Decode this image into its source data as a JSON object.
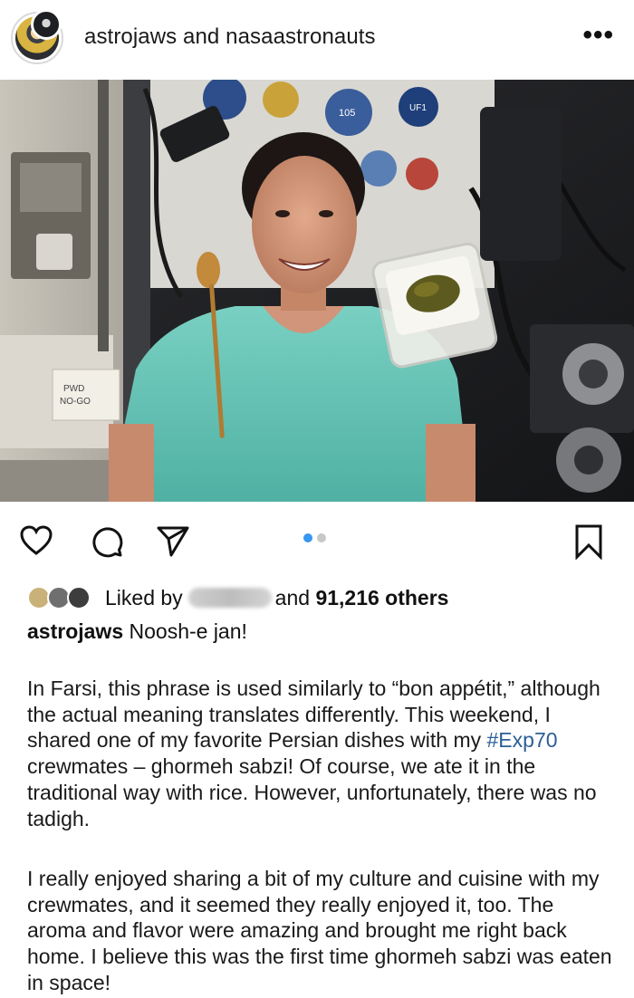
{
  "header": {
    "usernames": "astrojaws and nasaastronauts",
    "more_label": "•••"
  },
  "carousel": {
    "dot_colors": [
      "#3897f0",
      "#c8c8c8"
    ]
  },
  "photo": {
    "note_text_1": "PWD",
    "note_text_2": "NO-GO",
    "patch_label_1": "105",
    "patch_label_2": "UF1"
  },
  "likes": {
    "prefix": "Liked by",
    "suffix_and": "and",
    "count": "91,216 others"
  },
  "caption": {
    "username": "astrojaws",
    "headline": "Noosh-e jan!",
    "p1_a": "In Farsi, this phrase is used similarly to “bon appétit,” although the actual meaning translates differently. This weekend, I shared one of my favorite Persian dishes with my ",
    "hashtag": "#Exp70",
    "p1_b": " crewmates – ghormeh sabzi! Of course, we ate it in the traditional way with rice. However, unfortunately, there was no tadigh.",
    "p2": "I really enjoyed sharing a bit of my culture and cuisine with my crewmates, and it seemed they really enjoyed it, too. The aroma and flavor were amazing and brought me right back home. I believe this was the first time ghormeh sabzi was eaten in space!"
  },
  "icons": {
    "like": "heart-icon",
    "comment": "comment-bubble-icon",
    "share": "paper-plane-icon",
    "save": "bookmark-icon",
    "more": "more-options-icon"
  }
}
